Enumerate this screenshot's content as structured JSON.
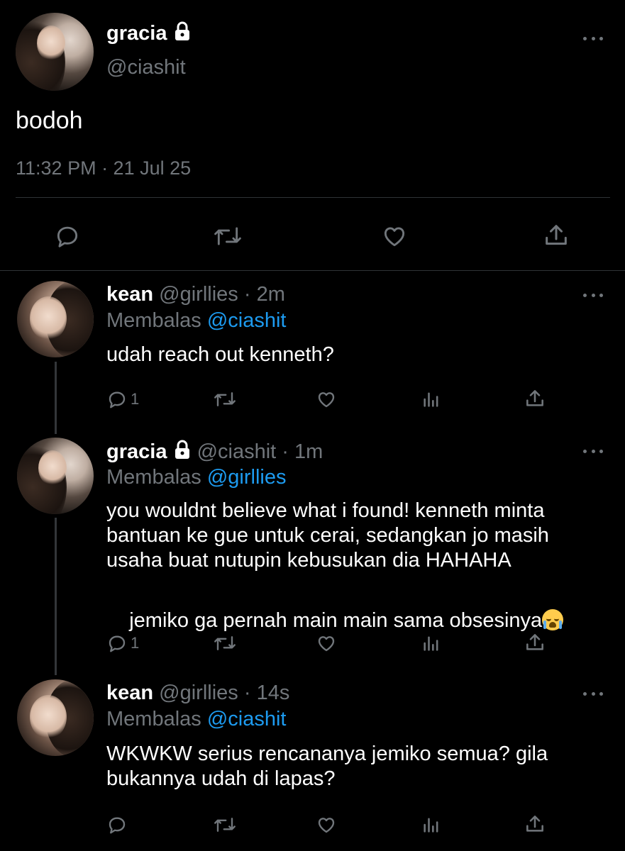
{
  "main_tweet": {
    "display_name": "gracia",
    "handle": "@ciashit",
    "text": "bodoh",
    "timestamp": "11:32 PM · 21 Jul 25",
    "actions": [
      "reply-icon",
      "retweet-icon",
      "like-icon",
      "share-icon"
    ]
  },
  "replies": [
    {
      "display_name": "kean",
      "handle": "@girllies",
      "time": "· 2m",
      "replying_label": "Membalas",
      "replying_to": "@ciashit",
      "text": "udah reach out kenneth?",
      "reply_count": "1"
    },
    {
      "display_name": "gracia",
      "handle": "@ciashit",
      "time": "· 1m",
      "replying_label": "Membalas",
      "replying_to": "@girllies",
      "text_line1": "you wouldnt believe what i found! kenneth minta",
      "text_line2": "bantuan ke gue untuk cerai, sedangkan jo masih",
      "text_line3": "usaha buat nutupin kebusukan dia HAHAHA",
      "text_line4": "jemiko ga pernah main main sama obsesinya",
      "emoji": "loudly-crying-face",
      "reply_count": "1"
    },
    {
      "display_name": "kean",
      "handle": "@girllies",
      "time": "· 14s",
      "replying_label": "Membalas",
      "replying_to": "@ciashit",
      "text_line1": "WKWKW serius rencananya jemiko semua? gila",
      "text_line2": "bukannya udah di lapas?",
      "reply_count": ""
    }
  ],
  "colors": {
    "background": "#000000",
    "muted": "#71767b",
    "link": "#1d9bf0",
    "divider": "#2f3336"
  }
}
